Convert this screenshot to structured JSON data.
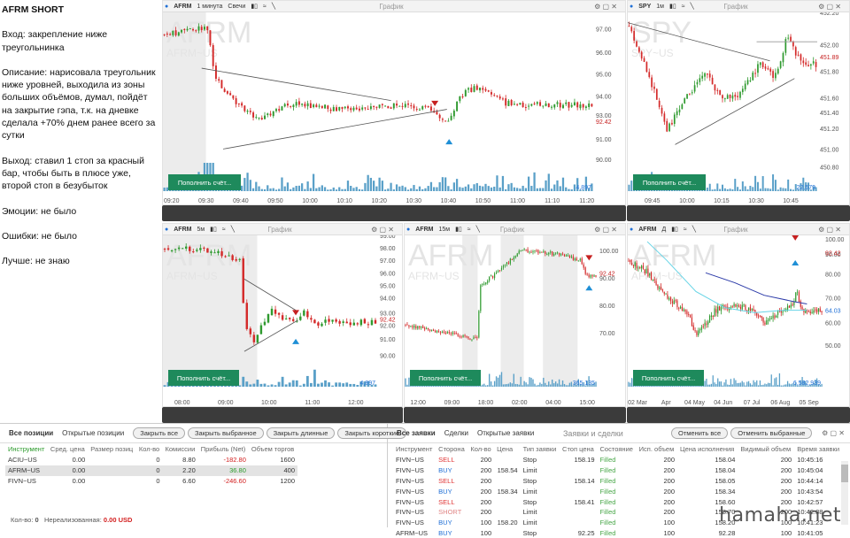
{
  "notes": {
    "title": "AFRM SHORT",
    "entry": "Вход: закрепление ниже треугольнинка",
    "description": "Описание: нарисовала треугольник ниже уровней, выходила из зоны больших объёмов, думал, пойдёт на закрытие гэпа, т.к. на дневке сделала +70% днем ранее всего за сутки",
    "exit": "Выход: ставил 1 стоп за красный бар, чтобы быть в плюсе уже, второй стоп в безубыток",
    "emotions": "Эмоции: не было",
    "errors": "Ошибки: не было",
    "better": "Лучше: не знаю"
  },
  "chart_title": "График",
  "fill_button": "Пополнить счёт...",
  "watermark_sym": "AFRM",
  "watermark_sub": "AFRM~US",
  "spy_watermark": "SPY",
  "spy_watermark_sub": "SPY~US",
  "charts": {
    "c1": {
      "symbol": "AFRM",
      "interval": "1 минута",
      "type": "Свечи",
      "price": "92.42",
      "volume": "4,897",
      "yticks": [
        "97.00",
        "96.00",
        "95.00",
        "94.00",
        "93.00",
        "91.00",
        "90.00"
      ],
      "xticks": [
        "09:20",
        "09:30",
        "09:40",
        "09:50",
        "10:00",
        "10:10",
        "10:20",
        "10:30",
        "10:40",
        "10:50",
        "11:00",
        "11:10",
        "11:20"
      ]
    },
    "c2": {
      "symbol": "SPY",
      "interval": "1м",
      "price": "451.89",
      "volume": "22,579",
      "yticks": [
        "452.20",
        "452.00",
        "451.80",
        "451.60",
        "451.40",
        "451.20",
        "451.00",
        "450.80"
      ],
      "xticks": [
        "09:45",
        "10:00",
        "10:15",
        "10:30",
        "10:45"
      ]
    },
    "c3": {
      "symbol": "AFRM",
      "interval": "5м",
      "price": "92.42",
      "volume": "4,897",
      "yticks": [
        "99.00",
        "98.00",
        "97.00",
        "96.00",
        "95.00",
        "94.00",
        "93.00",
        "92.00",
        "91.00",
        "90.00"
      ],
      "xticks": [
        "08:00",
        "09:00",
        "10:00",
        "11:00",
        "12:00"
      ]
    },
    "c4": {
      "symbol": "AFRM",
      "interval": "15м",
      "price": "92.42",
      "volume": "365,135",
      "yticks": [
        "100.00",
        "90.00",
        "80.00",
        "70.00"
      ],
      "xticks": [
        "12:00",
        "09:00",
        "18:00",
        "02:00",
        "04:00",
        "15:00"
      ]
    },
    "c5": {
      "symbol": "AFRM",
      "interval": "Д",
      "price": "92.42",
      "price2": "64.03",
      "volume": "6,582,939",
      "yticks": [
        "100.00",
        "90.00",
        "80.00",
        "70.00",
        "60.00",
        "50.00"
      ],
      "xticks": [
        "02 Mar",
        "Apr",
        "04 May",
        "04 Jun",
        "07 Jul",
        "06 Aug",
        "05 Sep"
      ]
    }
  },
  "positions": {
    "tabs": [
      "Все позиции",
      "Открытые позиции"
    ],
    "buttons": [
      "Закрыть все",
      "Закрыть выбранное",
      "Закрыть длинные",
      "Закрыть короткие"
    ],
    "columns": [
      "Инструмент",
      "Сред. цена",
      "Размер позиц",
      "Кол-во",
      "Комиссии",
      "Прибыль (Net)",
      "Объем торгов"
    ],
    "rows": [
      [
        "ACIU~US",
        "0.00",
        "",
        "0",
        "8.80",
        "-182.80",
        "1600"
      ],
      [
        "AFRM~US",
        "0.00",
        "",
        "0",
        "2.20",
        "36.80",
        "400"
      ],
      [
        "FIVN~US",
        "0.00",
        "",
        "0",
        "6.60",
        "-246.60",
        "1200"
      ]
    ],
    "footer_qty_label": "Кол-во:",
    "footer_qty": "0",
    "footer_unreal_label": "Нереализованная:",
    "footer_unreal": "0.00 USD"
  },
  "orders": {
    "tabs": [
      "Все заявки",
      "Сделки",
      "Открытые заявки"
    ],
    "title": "Заявки и сделки",
    "buttons": [
      "Отменить все",
      "Отменить выбранные"
    ],
    "columns": [
      "Инструмент",
      "Сторона",
      "Кол-во",
      "Цена",
      "Тип заявки",
      "Стоп цена",
      "Состояние",
      "Исп. объем",
      "Цена исполнения",
      "Видимый объем",
      "Время заявки"
    ],
    "rows": [
      [
        "FIVN~US",
        "SELL",
        "200",
        "",
        "Stop",
        "158.19",
        "Filled",
        "200",
        "158.04",
        "200",
        "10:45:16"
      ],
      [
        "FIVN~US",
        "BUY",
        "200",
        "158.54",
        "Limit",
        "",
        "Filled",
        "200",
        "158.04",
        "200",
        "10:45:04"
      ],
      [
        "FIVN~US",
        "SELL",
        "200",
        "",
        "Stop",
        "158.14",
        "Filled",
        "200",
        "158.05",
        "200",
        "10:44:14"
      ],
      [
        "FIVN~US",
        "BUY",
        "200",
        "158.34",
        "Limit",
        "",
        "Filled",
        "200",
        "158.34",
        "200",
        "10:43:54"
      ],
      [
        "FIVN~US",
        "SELL",
        "200",
        "",
        "Stop",
        "158.41",
        "Filled",
        "200",
        "158.60",
        "200",
        "10:42:57"
      ],
      [
        "FIVN~US",
        "SHORT",
        "200",
        "",
        "Limit",
        "",
        "Filled",
        "200",
        "158.70",
        "200",
        "10:42:38"
      ],
      [
        "FIVN~US",
        "BUY",
        "100",
        "158.20",
        "Limit",
        "",
        "Filled",
        "100",
        "158.20",
        "100",
        "10:41:23"
      ],
      [
        "AFRM~US",
        "BUY",
        "100",
        "",
        "Stop",
        "92.25",
        "Filled",
        "100",
        "92.28",
        "100",
        "10:41:05"
      ]
    ]
  },
  "watermark": "hamaha.net"
}
